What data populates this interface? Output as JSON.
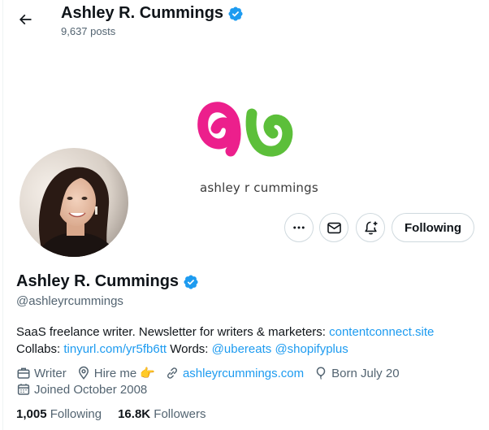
{
  "header": {
    "title": "Ashley R. Cummings",
    "post_count": "9,637 posts"
  },
  "banner": {
    "logo_text": "ashley r cummings"
  },
  "profile": {
    "name": "Ashley R. Cummings",
    "handle": "@ashleyrcummings",
    "verified_icon": "verified-badge-icon",
    "bio": {
      "line1_text": "SaaS freelance writer. Newsletter for writers & marketers: ",
      "line1_link": "contentconnect.site",
      "line2_prefix": "Collabs: ",
      "line2_link": "tinyurl.com/yr5fb6tt",
      "line2_mid": " Words: ",
      "mention1": "@ubereats",
      "mention2": "@shopifyplus"
    },
    "meta": {
      "category": "Writer",
      "location": "Hire me",
      "location_emoji": "👉",
      "website": "ashleyrcummings.com",
      "birthday": "Born July 20",
      "joined": "Joined October 2008"
    },
    "stats": {
      "following_count": "1,005",
      "following_label": "Following",
      "followers_count": "16.8K",
      "followers_label": "Followers"
    }
  },
  "actions": {
    "more_icon": "more-icon",
    "message_icon": "envelope-icon",
    "notify_icon": "bell-plus-icon",
    "follow_label": "Following"
  },
  "colors": {
    "accent": "#1d9bf0",
    "secondary_text": "#536471",
    "primary_text": "#0f1419",
    "border": "#cfd9de",
    "logo_pink": "#ec1f8c",
    "logo_green": "#5cbf3a"
  }
}
